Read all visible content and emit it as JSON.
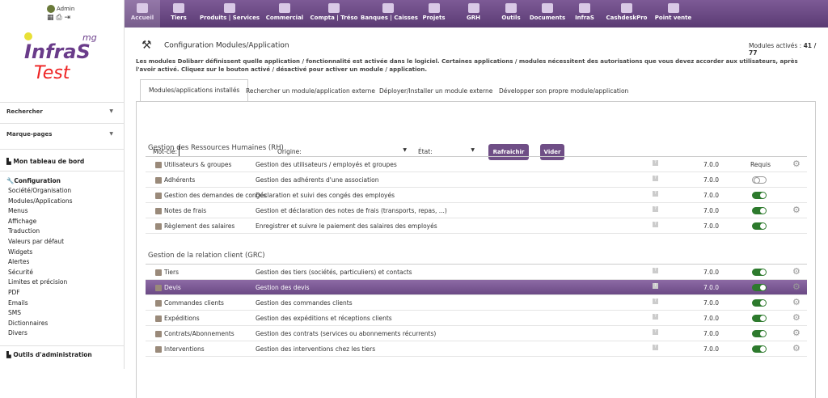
{
  "user": {
    "name": "Admin"
  },
  "logo": {
    "superscript": "mg",
    "line1": "InfraS",
    "line2": "Test"
  },
  "nav": [
    {
      "label": "Accueil",
      "active": true
    },
    {
      "label": "Tiers"
    },
    {
      "label": "Produits | Services"
    },
    {
      "label": "Commercial"
    },
    {
      "label": "Compta | Tréso"
    },
    {
      "label": "Banques | Caisses"
    },
    {
      "label": "Projets"
    },
    {
      "label": "GRH"
    },
    {
      "label": "Outils"
    },
    {
      "label": "Documents"
    },
    {
      "label": "InfraS"
    },
    {
      "label": "CashdeskPro"
    },
    {
      "label": "Point vente"
    }
  ],
  "sidebar": {
    "search": "Rechercher",
    "bookmarks": "Marque-pages",
    "dashboard": "Mon tableau de bord",
    "config_title": "Configuration",
    "config_items": [
      "Société/Organisation",
      "Modules/Applications",
      "Menus",
      "Affichage",
      "Traduction",
      "Valeurs par défaut",
      "Widgets",
      "Alertes",
      "Sécurité",
      "Limites et précision",
      "PDF",
      "Emails",
      "SMS",
      "Dictionnaires",
      "Divers"
    ],
    "admin_tools": "Outils d'administration"
  },
  "page": {
    "title": "Configuration Modules/Application",
    "count_label": "Modules activés : ",
    "count": "41 / 77",
    "description": "Les modules Dolibarr définissent quelle application / fonctionnalité est activée dans le logiciel. Certaines applications / modules nécessitent des autorisations que vous devez accorder aux utilisateurs, après l'avoir activé. Cliquez sur le bouton activé / désactivé pour activer un module / application."
  },
  "tabs": [
    "Modules/applications installés",
    "Rechercher un module/application externe",
    "Déployer/Installer un module externe",
    "Développer son propre module/application"
  ],
  "filters": {
    "keyword_label": "Mot-clé:",
    "origin_label": "Origine:",
    "state_label": "État:",
    "refresh": "Rafraichir",
    "clear": "Vider"
  },
  "groups": [
    {
      "title": "Gestion des Ressources Humaines (RH)",
      "rows": [
        {
          "name": "Utilisateurs & groupes",
          "desc": "Gestion des utilisateurs / employés et groupes",
          "version": "7.0.0",
          "status": "Requis",
          "gear": true
        },
        {
          "name": "Adhérents",
          "desc": "Gestion des adhérents d'une association",
          "version": "7.0.0",
          "status": "off",
          "gear": false
        },
        {
          "name": "Gestion des demandes de congés",
          "desc": "Déclaration et suivi des congés des employés",
          "version": "7.0.0",
          "status": "on",
          "gear": false
        },
        {
          "name": "Notes de frais",
          "desc": "Gestion et déclaration des notes de frais (transports, repas, ...)",
          "version": "7.0.0",
          "status": "on",
          "gear": true
        },
        {
          "name": "Règlement des salaires",
          "desc": "Enregistrer et suivre le paiement des salaires des employés",
          "version": "7.0.0",
          "status": "on",
          "gear": false
        }
      ]
    },
    {
      "title": "Gestion de la relation client (GRC)",
      "rows": [
        {
          "name": "Tiers",
          "desc": "Gestion des tiers (sociétés, particuliers) et contacts",
          "version": "7.0.0",
          "status": "on",
          "gear": true
        },
        {
          "name": "Devis",
          "desc": "Gestion des devis",
          "version": "7.0.0",
          "status": "on",
          "gear": true,
          "hl": true
        },
        {
          "name": "Commandes clients",
          "desc": "Gestion des commandes clients",
          "version": "7.0.0",
          "status": "on",
          "gear": true
        },
        {
          "name": "Expéditions",
          "desc": "Gestion des expéditions et réceptions clients",
          "version": "7.0.0",
          "status": "on",
          "gear": true
        },
        {
          "name": "Contrats/Abonnements",
          "desc": "Gestion des contrats (services ou abonnements récurrents)",
          "version": "7.0.0",
          "status": "on",
          "gear": true
        },
        {
          "name": "Interventions",
          "desc": "Gestion des interventions chez les tiers",
          "version": "7.0.0",
          "status": "on",
          "gear": true
        }
      ]
    }
  ]
}
